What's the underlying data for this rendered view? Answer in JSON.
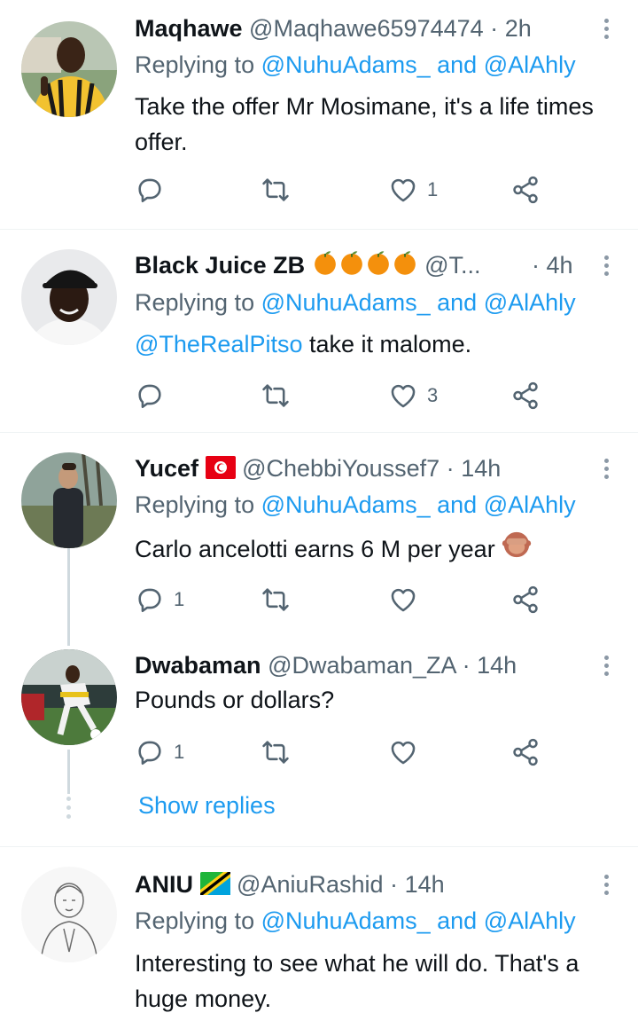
{
  "tweets": [
    {
      "name": "Maqhawe",
      "handle": "@Maqhawe65974474",
      "dot": "·",
      "time": "2h",
      "replying_prefix": "Replying to",
      "replying_1": "@NuhuAdams_",
      "replying_and": "and",
      "replying_2": "@AlAhly",
      "text": "Take the offer Mr Mosimane, it's a life times offer.",
      "reply_count": "",
      "retweet_count": "",
      "like_count": "1"
    },
    {
      "name": "Black Juice ZB",
      "emojis": "orange-fruit x4",
      "handle": "@T...",
      "dot": "·",
      "time": "4h",
      "replying_prefix": "Replying to",
      "replying_1": "@NuhuAdams_",
      "replying_and": "and",
      "replying_2": "@AlAhly",
      "text_mention": "@TheRealPitso",
      "text": "take it malome.",
      "reply_count": "",
      "retweet_count": "",
      "like_count": "3"
    },
    {
      "name": "Yucef",
      "emojis": "tunisia-flag",
      "handle": "@ChebbiYoussef7",
      "dot": "·",
      "time": "14h",
      "replying_prefix": "Replying to",
      "replying_1": "@NuhuAdams_",
      "replying_and": "and",
      "replying_2": "@AlAhly",
      "text": "Carlo ancelotti earns 6 M per year",
      "text_emoji": "speak-no-evil-monkey",
      "reply_count": "1",
      "retweet_count": "",
      "like_count": ""
    },
    {
      "name": "Dwabaman",
      "handle": "@Dwabaman_ZA",
      "dot": "·",
      "time": "14h",
      "text": "Pounds or dollars?",
      "reply_count": "1",
      "retweet_count": "",
      "like_count": ""
    },
    {
      "name": "ANIU",
      "emojis": "tanzania-flag",
      "handle": "@AniuRashid",
      "dot": "·",
      "time": "14h",
      "replying_prefix": "Replying to",
      "replying_1": "@NuhuAdams_",
      "replying_and": "and",
      "replying_2": "@AlAhly",
      "text": "Interesting to see what he will do. That's a huge money."
    }
  ],
  "show_replies": "Show replies",
  "colors": {
    "accent": "#1d9bf0",
    "secondary_text": "#536471",
    "primary_text": "#0f1419",
    "divider": "#eff3f4"
  },
  "icons": [
    "reply-icon",
    "retweet-icon",
    "like-icon",
    "share-icon",
    "more-icon"
  ]
}
